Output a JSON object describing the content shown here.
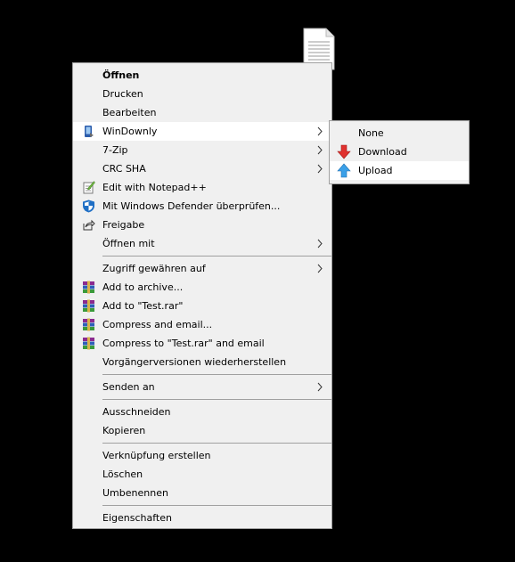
{
  "menu": {
    "items": [
      {
        "label": "Öffnen"
      },
      {
        "label": "Drucken"
      },
      {
        "label": "Bearbeiten"
      },
      {
        "label": "WinDownly"
      },
      {
        "label": "7-Zip"
      },
      {
        "label": "CRC SHA"
      },
      {
        "label": "Edit with Notepad++"
      },
      {
        "label": "Mit Windows Defender überprüfen..."
      },
      {
        "label": "Freigabe"
      },
      {
        "label": "Öffnen mit"
      },
      {
        "label": "Zugriff gewähren auf"
      },
      {
        "label": "Add to archive..."
      },
      {
        "label": "Add to \"Test.rar\""
      },
      {
        "label": "Compress and email..."
      },
      {
        "label": "Compress to \"Test.rar\" and email"
      },
      {
        "label": "Vorgängerversionen wiederherstellen"
      },
      {
        "label": "Senden an"
      },
      {
        "label": "Ausschneiden"
      },
      {
        "label": "Kopieren"
      },
      {
        "label": "Verknüpfung erstellen"
      },
      {
        "label": "Löschen"
      },
      {
        "label": "Umbenennen"
      },
      {
        "label": "Eigenschaften"
      }
    ]
  },
  "submenu": {
    "items": [
      {
        "label": "None"
      },
      {
        "label": "Download"
      },
      {
        "label": "Upload"
      }
    ]
  },
  "colors": {
    "menu_bg": "#f0f0f0",
    "hover_bg": "#ffffff",
    "border": "#a0a0a0",
    "download_arrow": "#e0312e",
    "upload_arrow": "#3aa0e8"
  }
}
